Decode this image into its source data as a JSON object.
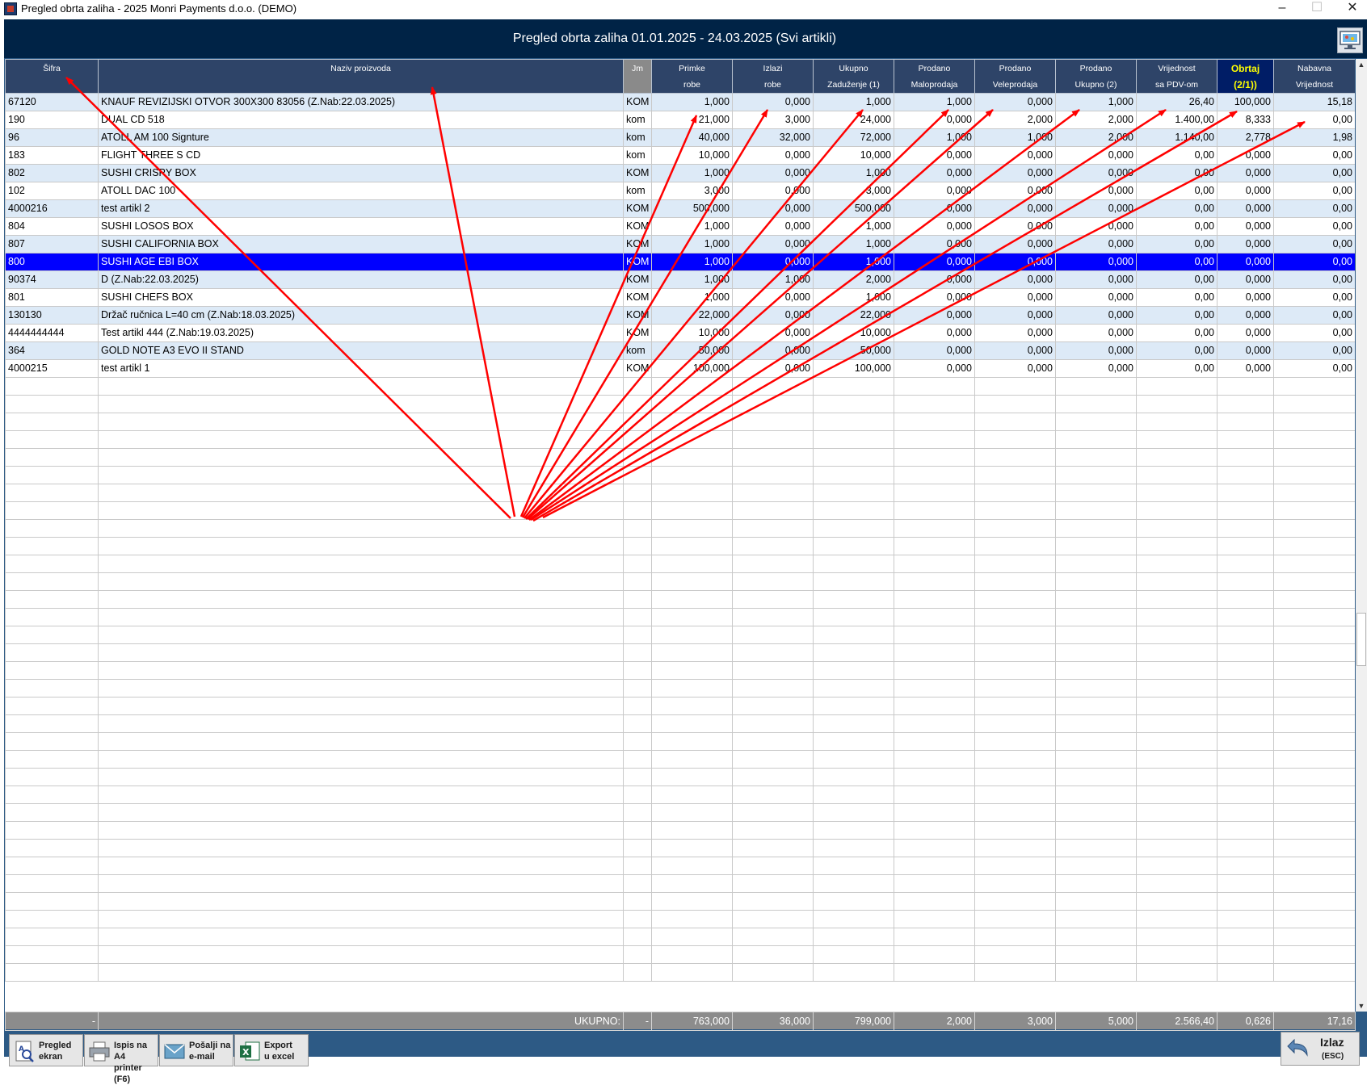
{
  "window": {
    "title": "Pregled obrta zaliha - 2025 Monri Payments d.o.o. (DEMO)",
    "minimize": "–",
    "maximize": "☐",
    "close": "✕"
  },
  "header": {
    "title": "Pregled obrta zaliha 01.01.2025 - 24.03.2025 (Svi artikli)"
  },
  "columns": [
    {
      "l1": "Šifra",
      "l2": ""
    },
    {
      "l1": "Naziv proizvoda",
      "l2": ""
    },
    {
      "l1": "Jm",
      "l2": ""
    },
    {
      "l1": "Primke",
      "l2": "robe"
    },
    {
      "l1": "Izlazi",
      "l2": "robe"
    },
    {
      "l1": "Ukupno",
      "l2": "Zaduženje (1)"
    },
    {
      "l1": "Prodano",
      "l2": "Maloprodaja"
    },
    {
      "l1": "Prodano",
      "l2": "Veleprodaja"
    },
    {
      "l1": "Prodano",
      "l2": "Ukupno (2)"
    },
    {
      "l1": "Vrijednost",
      "l2": "sa PDV-om"
    },
    {
      "l1": "Obrtaj",
      "l2": "(2/1))"
    },
    {
      "l1": "Nabavna",
      "l2": "Vrijednost"
    }
  ],
  "rows": [
    [
      "67120",
      "KNAUF REVIZIJSKI OTVOR 300X300 83056  (Z.Nab:22.03.2025)",
      "KOM",
      "1,000",
      "0,000",
      "1,000",
      "1,000",
      "0,000",
      "1,000",
      "26,40",
      "100,000",
      "15,18"
    ],
    [
      "190",
      "DUAL CD 518",
      "kom",
      "21,000",
      "3,000",
      "24,000",
      "0,000",
      "2,000",
      "2,000",
      "1.400,00",
      "8,333",
      "0,00"
    ],
    [
      "96",
      "ATOLL AM 100 Signture",
      "kom",
      "40,000",
      "32,000",
      "72,000",
      "1,000",
      "1,000",
      "2,000",
      "1.140,00",
      "2,778",
      "1,98"
    ],
    [
      "183",
      "FLIGHT THREE S CD",
      "kom",
      "10,000",
      "0,000",
      "10,000",
      "0,000",
      "0,000",
      "0,000",
      "0,00",
      "0,000",
      "0,00"
    ],
    [
      "802",
      "SUSHI CRISPY BOX",
      "KOM",
      "1,000",
      "0,000",
      "1,000",
      "0,000",
      "0,000",
      "0,000",
      "0,00",
      "0,000",
      "0,00"
    ],
    [
      "102",
      "ATOLL DAC 100",
      "kom",
      "3,000",
      "0,000",
      "3,000",
      "0,000",
      "0,000",
      "0,000",
      "0,00",
      "0,000",
      "0,00"
    ],
    [
      "4000216",
      "test artikl 2",
      "KOM",
      "500,000",
      "0,000",
      "500,000",
      "0,000",
      "0,000",
      "0,000",
      "0,00",
      "0,000",
      "0,00"
    ],
    [
      "804",
      "SUSHI LOSOS BOX",
      "KOM",
      "1,000",
      "0,000",
      "1,000",
      "0,000",
      "0,000",
      "0,000",
      "0,00",
      "0,000",
      "0,00"
    ],
    [
      "807",
      "SUSHI CALIFORNIA BOX",
      "KOM",
      "1,000",
      "0,000",
      "1,000",
      "0,000",
      "0,000",
      "0,000",
      "0,00",
      "0,000",
      "0,00"
    ],
    [
      "800",
      "SUSHI AGE EBI BOX",
      "KOM",
      "1,000",
      "0,000",
      "1,000",
      "0,000",
      "0,000",
      "0,000",
      "0,00",
      "0,000",
      "0,00"
    ],
    [
      "90374",
      "D   (Z.Nab:22.03.2025)",
      "KOM",
      "1,000",
      "1,000",
      "2,000",
      "0,000",
      "0,000",
      "0,000",
      "0,00",
      "0,000",
      "0,00"
    ],
    [
      "801",
      "SUSHI CHEFS BOX",
      "KOM",
      "1,000",
      "0,000",
      "1,000",
      "0,000",
      "0,000",
      "0,000",
      "0,00",
      "0,000",
      "0,00"
    ],
    [
      "130130",
      "Držač ručnica L=40 cm   (Z.Nab:18.03.2025)",
      "KOM",
      "22,000",
      "0,000",
      "22,000",
      "0,000",
      "0,000",
      "0,000",
      "0,00",
      "0,000",
      "0,00"
    ],
    [
      "4444444444",
      "Test artikl 444   (Z.Nab:19.03.2025)",
      "KOM",
      "10,000",
      "0,000",
      "10,000",
      "0,000",
      "0,000",
      "0,000",
      "0,00",
      "0,000",
      "0,00"
    ],
    [
      "364",
      "GOLD NOTE A3 EVO II STAND",
      "kom",
      "50,000",
      "0,000",
      "50,000",
      "0,000",
      "0,000",
      "0,000",
      "0,00",
      "0,000",
      "0,00"
    ],
    [
      "4000215",
      "test artikl 1",
      "KOM",
      "100,000",
      "0,000",
      "100,000",
      "0,000",
      "0,000",
      "0,000",
      "0,00",
      "0,000",
      "0,00"
    ]
  ],
  "selected_row_code": "800",
  "totals": [
    "-",
    "UKUPNO:",
    "-",
    "763,000",
    "36,000",
    "799,000",
    "2,000",
    "3,000",
    "5,000",
    "2.566,40",
    "0,626",
    "17,16"
  ],
  "buttons": {
    "pregled": {
      "l1": "Pregled",
      "l2": "ekran"
    },
    "ispis": {
      "l1": "Ispis na A4",
      "l2": "printer (F6)"
    },
    "posalji": {
      "l1": "Pošalji na",
      "l2": "e-mail"
    },
    "export": {
      "l1": "Export",
      "l2": "u excel"
    },
    "izlaz": {
      "l1": "Izlaz",
      "l2": "(ESC)"
    }
  },
  "colors": {
    "header_bg": "#002346",
    "frame": "#2d5a85",
    "selected_row": "#0000ff",
    "alt_row": "#ddeaf7",
    "obrtaj_header_text": "#ffff00",
    "annotation_arrow": "#ff0000"
  }
}
